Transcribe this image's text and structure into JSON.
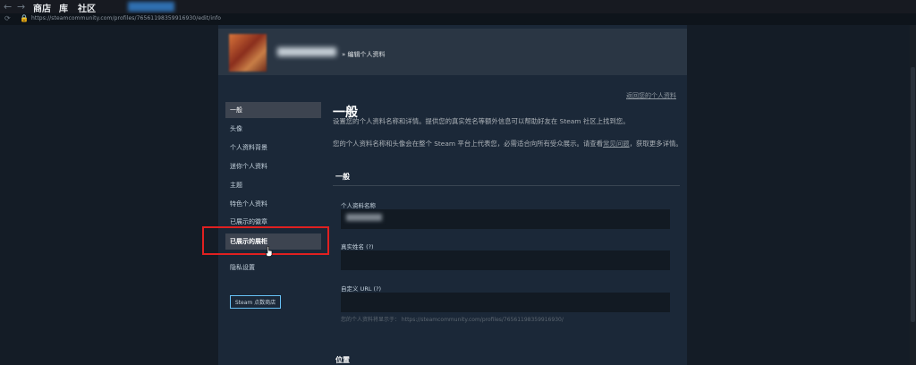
{
  "browser": {
    "back_icon": "back-arrow-icon",
    "forward_icon": "forward-arrow-icon",
    "nav": [
      "商店",
      "库",
      "社区"
    ],
    "url": "https://steamcommunity.com/profiles/76561198359916930/edit/info"
  },
  "header": {
    "breadcrumb": "» 编辑个人资料"
  },
  "back_link": "返回您的个人资料",
  "sidebar": {
    "items": [
      {
        "label": "一般"
      },
      {
        "label": "头像"
      },
      {
        "label": "个人资料背景"
      },
      {
        "label": "迷你个人资料"
      },
      {
        "label": "主题"
      },
      {
        "label": "特色个人资料"
      },
      {
        "label": "已展示的徽章"
      },
      {
        "label": "已展示的展柜"
      },
      {
        "label": "隐私设置"
      }
    ],
    "points_shop_button": "Steam 点数商店"
  },
  "main": {
    "title": "一般",
    "intro_1": "设置您的个人资料名称和详情。提供您的真实姓名等额外信息可以帮助好友在 Steam 社区上找到您。",
    "intro_2_a": "您的个人资料名称和头像会在整个 Steam 平台上代表您，必需适合向所有受众展示。请查看",
    "intro_2_link": "常见问题",
    "intro_2_b": "，获取更多详情。",
    "section_general": "一般",
    "profile_name_label": "个人资料名称",
    "real_name_label": "真实姓名 (?)",
    "custom_url_label": "自定义 URL (?)",
    "custom_url_hint": "您的个人资料将显示于：  https://steamcommunity.com/profiles/76561198359916930/",
    "section_location": "位置"
  },
  "colors": {
    "highlight": "#e02020",
    "accent": "#67c1f5"
  }
}
